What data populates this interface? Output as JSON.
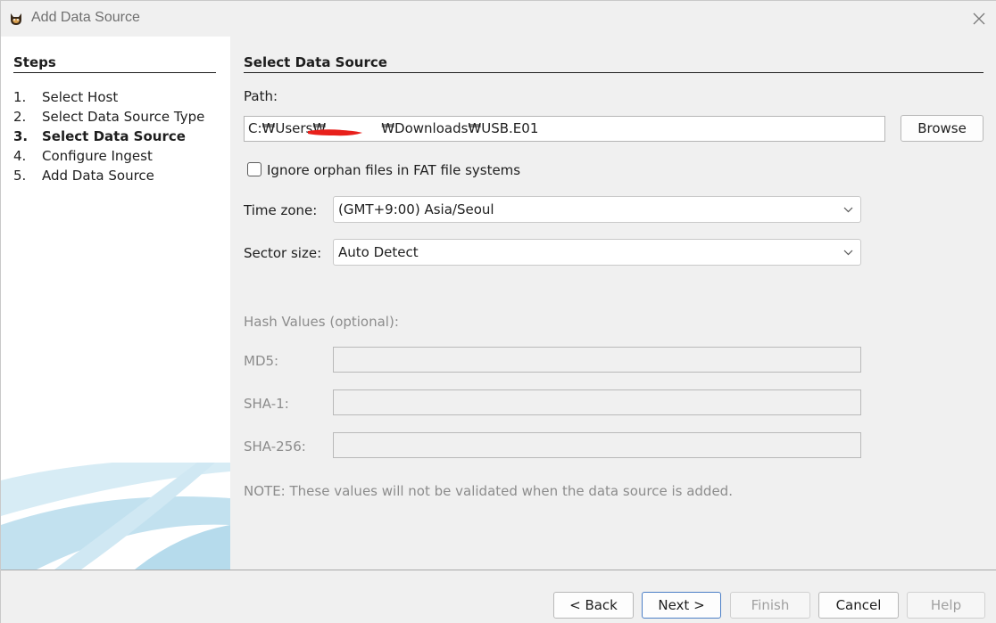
{
  "window": {
    "title": "Add Data Source",
    "app_icon": "autopsy-dog-icon",
    "close_icon": "close-icon"
  },
  "steps": {
    "heading": "Steps",
    "items": [
      {
        "num": "1.",
        "label": "Select Host",
        "current": false
      },
      {
        "num": "2.",
        "label": "Select Data Source Type",
        "current": false
      },
      {
        "num": "3.",
        "label": "Select Data Source",
        "current": true
      },
      {
        "num": "4.",
        "label": "Configure Ingest",
        "current": false
      },
      {
        "num": "5.",
        "label": "Add Data Source",
        "current": false
      }
    ]
  },
  "panel": {
    "title": "Select Data Source",
    "path_label": "Path:",
    "path_prefix": "C:₩Users₩",
    "path_suffix": "₩Downloads₩USB.E01",
    "browse_label": "Browse",
    "ignore_orphan_label": "Ignore orphan files in FAT file systems",
    "ignore_orphan_checked": false,
    "timezone_label": "Time zone:",
    "timezone_value": "(GMT+9:00) Asia/Seoul",
    "sector_label": "Sector size:",
    "sector_value": "Auto Detect",
    "hash_heading": "Hash Values (optional):",
    "md5_label": "MD5:",
    "md5_value": "",
    "sha1_label": "SHA-1:",
    "sha1_value": "",
    "sha256_label": "SHA-256:",
    "sha256_value": "",
    "note": "NOTE: These values will not be validated when the data source is added."
  },
  "footer": {
    "back_label": "< Back",
    "next_label": "Next >",
    "finish_label": "Finish",
    "cancel_label": "Cancel",
    "help_label": "Help"
  },
  "colors": {
    "accent": "#4c7fc6",
    "redaction": "#e8201b",
    "swoosh": "#bfe0ef"
  }
}
